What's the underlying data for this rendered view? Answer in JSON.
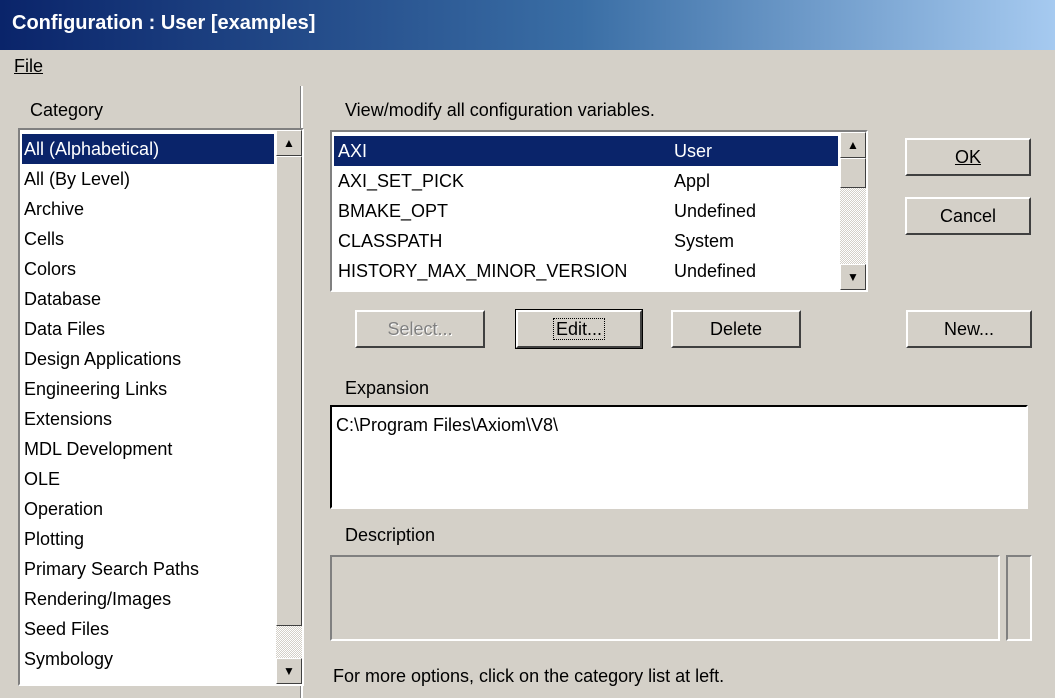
{
  "window": {
    "title": "Configuration : User [examples]"
  },
  "menu": {
    "file": "File"
  },
  "category": {
    "label": "Category",
    "items": [
      "All (Alphabetical)",
      "All (By Level)",
      "Archive",
      "Cells",
      "Colors",
      "Database",
      "Data Files",
      "Design Applications",
      "Engineering Links",
      "Extensions",
      "MDL Development",
      "OLE",
      "Operation",
      "Plotting",
      "Primary Search Paths",
      "Rendering/Images",
      "Seed Files",
      "Symbology"
    ],
    "selected_index": 0
  },
  "variables": {
    "header": "View/modify all configuration variables.",
    "rows": [
      {
        "name": "AXI",
        "level": "User"
      },
      {
        "name": "AXI_SET_PICK",
        "level": "Appl"
      },
      {
        "name": "BMAKE_OPT",
        "level": "Undefined"
      },
      {
        "name": "CLASSPATH",
        "level": "System"
      },
      {
        "name": "HISTORY_MAX_MINOR_VERSION",
        "level": "Undefined"
      }
    ],
    "selected_index": 0
  },
  "buttons": {
    "ok": "OK",
    "cancel": "Cancel",
    "select": "Select...",
    "edit": "Edit...",
    "delete": "Delete",
    "new": "New..."
  },
  "expansion": {
    "label": "Expansion",
    "value": "C:\\Program Files\\Axiom\\V8\\"
  },
  "description": {
    "label": "Description",
    "value": ""
  },
  "footer": {
    "hint": "For more options, click on the category list at left."
  },
  "colors": {
    "selection": "#0a246a",
    "face": "#d4d0c8"
  }
}
